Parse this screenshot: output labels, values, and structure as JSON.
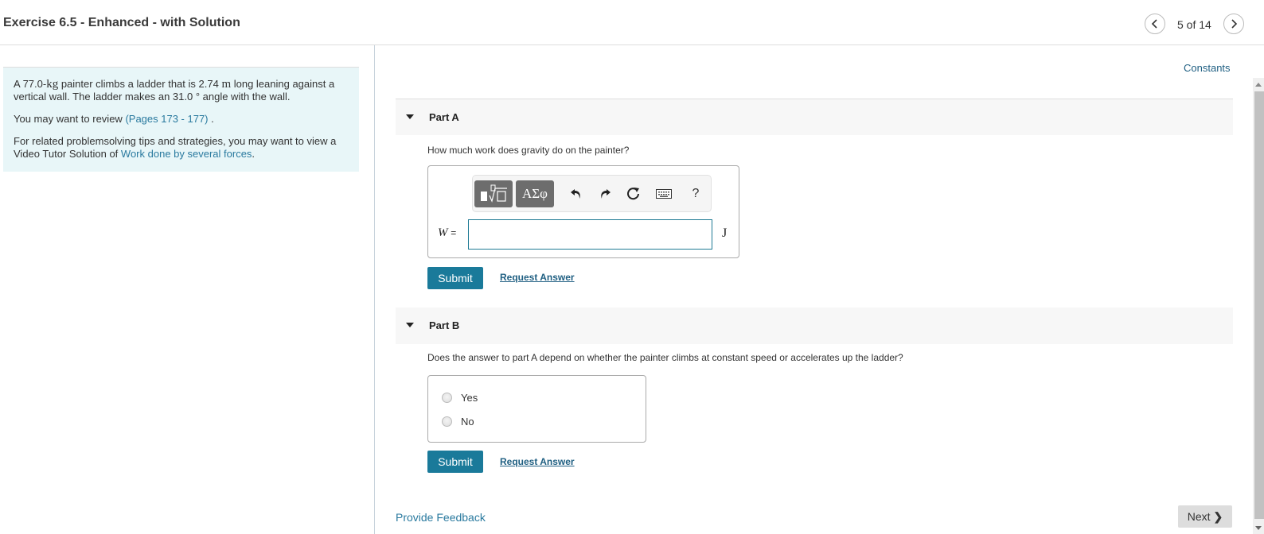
{
  "header": {
    "title": "Exercise 6.5 - Enhanced - with Solution",
    "pager": "5 of 14"
  },
  "problem": {
    "text_prefix": "A 77.0-",
    "mass_unit": "kg",
    "text_mid": " painter climbs a ladder that is 2.74 ",
    "length_unit": "m",
    "text_suffix": " long leaning against a vertical wall. The ladder makes an 31.0 ° angle with the wall.",
    "review_prefix": "You may want to review ",
    "review_link": "(Pages 173 - 177)",
    "review_suffix": " .",
    "tips_prefix": "For related problemsolving tips and strategies, you may want to view a Video Tutor Solution of ",
    "tips_link": "Work done by several forces",
    "tips_suffix": "."
  },
  "constants_link": "Constants",
  "part_a": {
    "title": "Part A",
    "question": "How much work does gravity do on the painter?",
    "toolbar": {
      "template_icon": "template-radical-icon",
      "greek_label": "ΑΣφ",
      "undo_icon": "undo-icon",
      "redo_icon": "redo-icon",
      "reset_icon": "reset-icon",
      "keyboard_icon": "keyboard-icon",
      "help_label": "?"
    },
    "variable": "W",
    "equals": "=",
    "input_value": "",
    "unit": "J",
    "submit_label": "Submit",
    "request_label": "Request Answer"
  },
  "part_b": {
    "title": "Part B",
    "question": "Does the answer to part A depend on whether the painter climbs at constant speed or accelerates up the ladder?",
    "choices": [
      {
        "label": "Yes",
        "selected": false
      },
      {
        "label": "No",
        "selected": false
      }
    ],
    "submit_label": "Submit",
    "request_label": "Request Answer"
  },
  "footer": {
    "feedback_label": "Provide Feedback",
    "next_label": "Next",
    "next_chevron": "❯"
  },
  "colors": {
    "accent": "#1a7a9a",
    "link": "#2a7a9f",
    "panel_bg": "#e8f6f8"
  }
}
